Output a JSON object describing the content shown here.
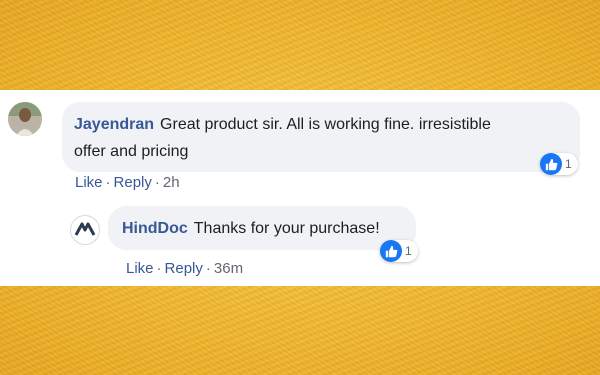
{
  "comments": [
    {
      "author": "Jayendran",
      "text": "Great product sir. All is working fine. irresistible offer and pricing",
      "text_line1": "Great product sir. All is working fine. irresistible",
      "text_line2": "offer and pricing",
      "reaction_count": "1",
      "actions": {
        "like": "Like",
        "reply": "Reply",
        "time": "2h"
      }
    },
    {
      "author": "HindDoc",
      "text": "Thanks for your purchase!",
      "reaction_count": "1",
      "actions": {
        "like": "Like",
        "reply": "Reply",
        "time": "36m"
      }
    }
  ],
  "icons": {
    "user_avatar": "user-avatar",
    "brand_avatar": "hinddoc-logo",
    "reaction": "thumbs-up-icon"
  },
  "colors": {
    "author": "#385898",
    "like_blue": "#1877f2",
    "bubble_bg": "#f0f2f5",
    "background": "#f1b62a"
  }
}
